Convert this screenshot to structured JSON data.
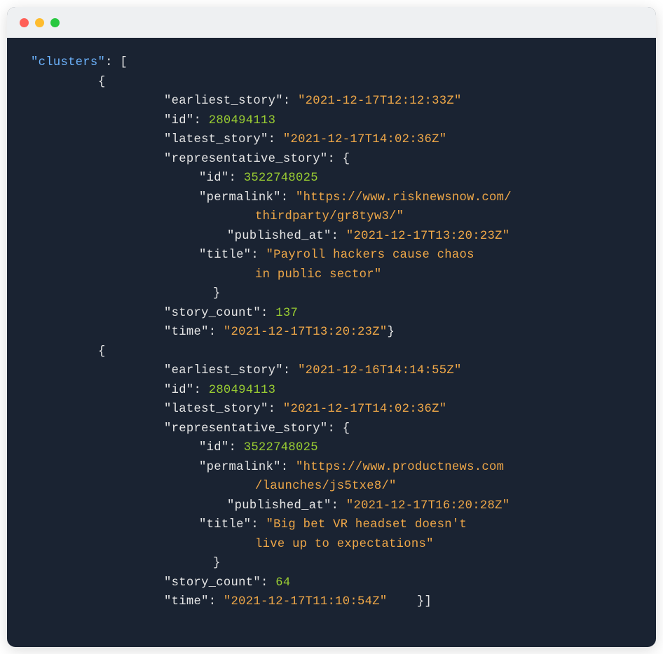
{
  "rootKey": "\"clusters\"",
  "clusters": [
    {
      "earliest_story": "\"2021-12-17T12:12:33Z\"",
      "id": "280494113",
      "latest_story": "\"2021-12-17T14:02:36Z\"",
      "rep_id": "3522748025",
      "permalink_l1": "\"https://www.risknewsnow.com/",
      "permalink_l2": "thirdparty/gr8tyw3/\"",
      "published_at": "\"2021-12-17T13:20:23Z\"",
      "title_l1": "\"Payroll hackers cause chaos",
      "title_l2": "in public sector\"",
      "story_count": "137",
      "time": "\"2021-12-17T13:20:23Z\""
    },
    {
      "earliest_story": "\"2021-12-16T14:14:55Z\"",
      "id": "280494113",
      "latest_story": "\"2021-12-17T14:02:36Z\"",
      "rep_id": "3522748025",
      "permalink_l1": "\"https://www.productnews.com",
      "permalink_l2": "/launches/js5txe8/\"",
      "published_at": "\"2021-12-17T16:20:28Z\"",
      "title_l1": "\"Big bet VR headset doesn't",
      "title_l2": "live up to expectations\"",
      "story_count": "64",
      "time": "\"2021-12-17T11:10:54Z\""
    }
  ],
  "labels": {
    "earliest_story": "\"earliest_story\"",
    "id": "\"id\"",
    "latest_story": "\"latest_story\"",
    "representative_story": "\"representative_story\"",
    "permalink": "\"permalink\"",
    "published_at": "\"published_at\"",
    "title": "\"title\"",
    "story_count": "\"story_count\"",
    "time": "\"time\""
  }
}
